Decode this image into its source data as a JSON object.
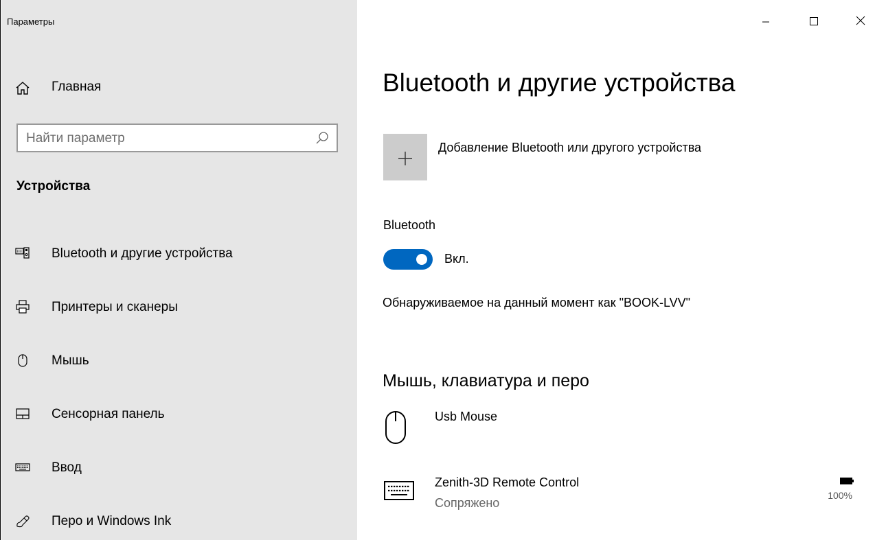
{
  "window": {
    "title": "Параметры"
  },
  "sidebar": {
    "home_label": "Главная",
    "search_placeholder": "Найти параметр",
    "section_heading": "Устройства",
    "items": [
      {
        "label": "Bluetooth и другие устройства",
        "icon": "bluetooth-devices-icon"
      },
      {
        "label": "Принтеры и сканеры",
        "icon": "printer-icon"
      },
      {
        "label": "Мышь",
        "icon": "mouse-icon"
      },
      {
        "label": "Сенсорная панель",
        "icon": "touchpad-icon"
      },
      {
        "label": "Ввод",
        "icon": "keyboard-icon"
      },
      {
        "label": "Перо и Windows Ink",
        "icon": "pen-icon"
      }
    ]
  },
  "main": {
    "title": "Bluetooth и другие устройства",
    "add_device_label": "Добавление Bluetooth или другого устройства",
    "bluetooth_label": "Bluetooth",
    "toggle_state": "Вкл.",
    "discoverable_text": "Обнаруживаемое на данный момент как \"BOOK-LVV\"",
    "section_heading": "Мышь, клавиатура и перо",
    "devices": [
      {
        "name": "Usb Mouse",
        "status": "",
        "icon": "mouse-icon"
      },
      {
        "name": "Zenith-3D Remote Control",
        "status": "Сопряжено",
        "icon": "keyboard-icon",
        "battery": "100%"
      }
    ]
  },
  "colors": {
    "sidebar_bg": "#e6e6e6",
    "accent": "#0067c0",
    "tile_bg": "#cccccc"
  }
}
